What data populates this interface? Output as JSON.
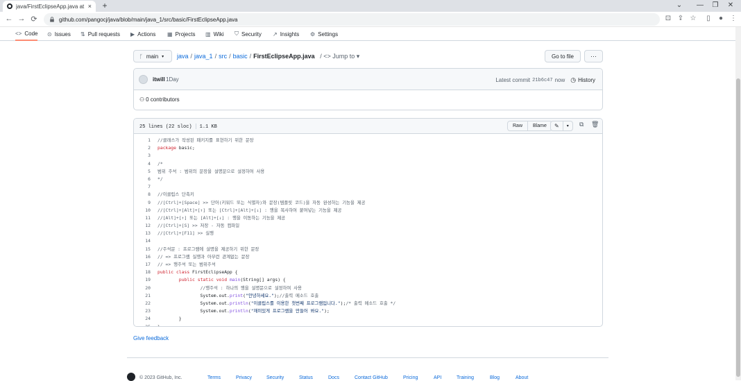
{
  "browser": {
    "tab_title": "java/FirstEclipseApp.java at mai",
    "tab_close": "×",
    "new_tab": "+",
    "url": "github.com/pangocj/java/blob/main/java_1/src/basic/FirstEclipseApp.java",
    "win_min": "⌄",
    "win_minimize": "—",
    "win_restore": "❐",
    "win_close": "✕",
    "back": "←",
    "forward": "→",
    "reload": "⟳"
  },
  "repo_nav": {
    "items": [
      {
        "label": "Code",
        "icon": "<>"
      },
      {
        "label": "Issues",
        "icon": "⊙"
      },
      {
        "label": "Pull requests",
        "icon": "⇅"
      },
      {
        "label": "Actions",
        "icon": "▶"
      },
      {
        "label": "Projects",
        "icon": "▦"
      },
      {
        "label": "Wiki",
        "icon": "▥"
      },
      {
        "label": "Security",
        "icon": "⛉"
      },
      {
        "label": "Insights",
        "icon": "↗"
      },
      {
        "label": "Settings",
        "icon": "⚙"
      }
    ]
  },
  "breadcrumb": {
    "branch": "main",
    "parts": [
      "java",
      "java_1",
      "src",
      "basic"
    ],
    "separator": "/",
    "file": "FirstEclipseApp.java",
    "jump": "/ <> Jump to ▾",
    "goto_label": "Go to file",
    "more_label": "···"
  },
  "commit": {
    "author": "itwill",
    "message": "1Day",
    "latest_label": "Latest commit",
    "hash": "21b6c47",
    "when": "now",
    "history_label": "History",
    "contributors": "0 contributors"
  },
  "file": {
    "lines_info": "25 lines (22 sloc)",
    "size": "1.1 KB",
    "raw_label": "Raw",
    "blame_label": "Blame",
    "code": [
      [
        {
          "t": "//클래스가 작성된 패키지를 표현하기 위한 문장",
          "c": "cm"
        }
      ],
      [
        {
          "t": "package",
          "c": "kw"
        },
        {
          "t": " basic;",
          "c": ""
        }
      ],
      [],
      [
        {
          "t": "/*",
          "c": "cm"
        }
      ],
      [
        {
          "t": "범위 주석 : 범위의 문장을 설명문으로 설정하여 사용",
          "c": "cm"
        }
      ],
      [
        {
          "t": "*/",
          "c": "cm"
        }
      ],
      [],
      [
        {
          "t": "//이클립스 단축키",
          "c": "cm"
        }
      ],
      [
        {
          "t": "//[Ctrl]+[Space] >> 단어(키워드 또는 식별자)와 문장(템플릿 코드)을 자동 완성하는 기능을 제공",
          "c": "cm"
        }
      ],
      [
        {
          "t": "//[Ctrl]+[Alt]+[↑] 또는 [Ctrl]+[Alt]+[↓] : 행을 복사하여 붙여넣는 기능을 제공",
          "c": "cm"
        }
      ],
      [
        {
          "t": "//[Alt]+[↑] 또는 [Alt]+[↓] : 행을 이동하는 기능을 제공",
          "c": "cm"
        }
      ],
      [
        {
          "t": "//[Ctrl]+[S] >> 저장 - 자동 컴파일",
          "c": "cm"
        }
      ],
      [
        {
          "t": "//[Ctrl]+[F11] >> 실행",
          "c": "cm"
        }
      ],
      [],
      [
        {
          "t": "//주석문 : 프로그램에 설명을 제공하기 위한 문장",
          "c": "cm"
        }
      ],
      [
        {
          "t": "// => 프로그램 실행과 아무런 관계없는 문장",
          "c": "cm"
        }
      ],
      [
        {
          "t": "// => 행주석 또는 범위주석",
          "c": "cm"
        }
      ],
      [
        {
          "t": "public",
          "c": "kw"
        },
        {
          "t": " ",
          "c": ""
        },
        {
          "t": "class",
          "c": "kw"
        },
        {
          "t": " FirstEclipseApp {",
          "c": ""
        }
      ],
      [
        {
          "t": "        ",
          "c": ""
        },
        {
          "t": "public",
          "c": "kw"
        },
        {
          "t": " ",
          "c": ""
        },
        {
          "t": "static",
          "c": "kw"
        },
        {
          "t": " ",
          "c": ""
        },
        {
          "t": "void",
          "c": "kw"
        },
        {
          "t": " ",
          "c": ""
        },
        {
          "t": "main",
          "c": "fn"
        },
        {
          "t": "(String[] args) {",
          "c": ""
        }
      ],
      [
        {
          "t": "                ",
          "c": ""
        },
        {
          "t": "//행주석 : 하나의 행을 설명문으로 설정하여 사용",
          "c": "cm"
        }
      ],
      [
        {
          "t": "                System.out.",
          "c": ""
        },
        {
          "t": "print",
          "c": "fn"
        },
        {
          "t": "(",
          "c": ""
        },
        {
          "t": "\"안녕하세요.\"",
          "c": "st"
        },
        {
          "t": ");",
          "c": ""
        },
        {
          "t": "//출력 메소드 호출",
          "c": "cm"
        }
      ],
      [
        {
          "t": "                System.out.",
          "c": ""
        },
        {
          "t": "println",
          "c": "fn"
        },
        {
          "t": "(",
          "c": ""
        },
        {
          "t": "\"이클립스를 이용한 첫번째 프로그램입니다.\"",
          "c": "st"
        },
        {
          "t": ");",
          "c": ""
        },
        {
          "t": "/* 출력 메소드 호출 */",
          "c": "cm"
        }
      ],
      [
        {
          "t": "                System.out.",
          "c": ""
        },
        {
          "t": "println",
          "c": "fn"
        },
        {
          "t": "(",
          "c": ""
        },
        {
          "t": "\"재미있게 프로그램을 만들어 봐요.\"",
          "c": "st"
        },
        {
          "t": ");",
          "c": ""
        }
      ],
      [
        {
          "t": "        }",
          "c": ""
        }
      ],
      [
        {
          "t": "}",
          "c": ""
        }
      ]
    ]
  },
  "feedback": "Give feedback",
  "footer": {
    "copyright": "© 2023 GitHub, Inc.",
    "links": [
      "Terms",
      "Privacy",
      "Security",
      "Status",
      "Docs",
      "Contact GitHub",
      "Pricing",
      "API",
      "Training",
      "Blog",
      "About"
    ]
  },
  "colors": {
    "accent": "#0969da",
    "active_tab": "#fd8c73",
    "keyword": "#cf222e",
    "string": "#0a3069",
    "comment": "#59636e"
  }
}
